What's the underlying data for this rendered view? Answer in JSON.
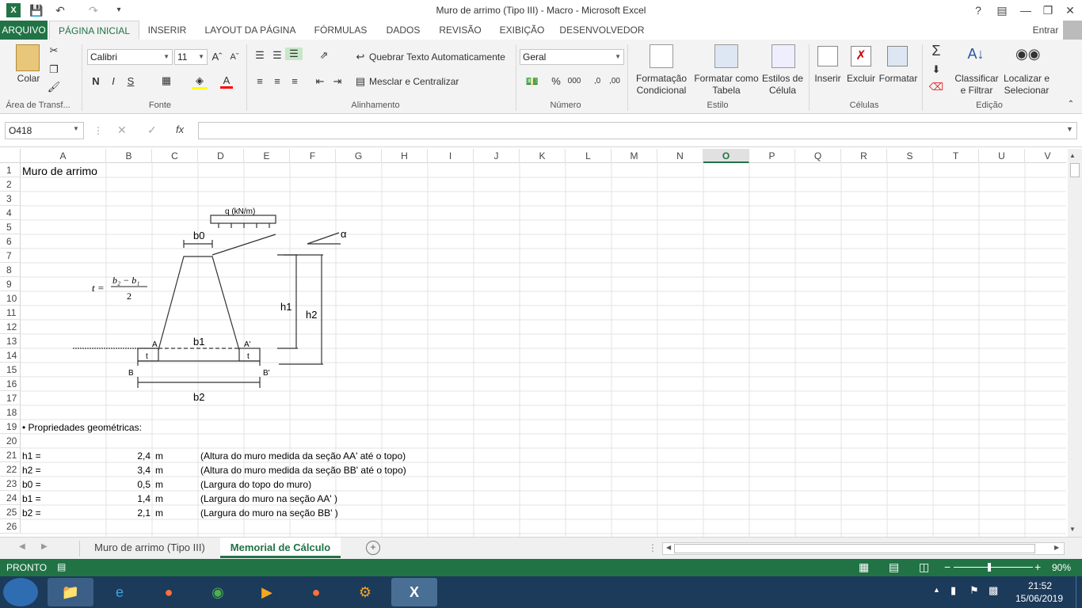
{
  "titlebar": {
    "title": "Muro de arrimo (Tipo III) - Macro - Microsoft Excel",
    "help": "?"
  },
  "tabs": [
    "ARQUIVO",
    "PÁGINA INICIAL",
    "INSERIR",
    "LAYOUT DA PÁGINA",
    "FÓRMULAS",
    "DADOS",
    "REVISÃO",
    "EXIBIÇÃO",
    "DESENVOLVEDOR"
  ],
  "signin": "Entrar",
  "ribbon": {
    "paste": "Colar",
    "font_name": "Calibri",
    "font_size": "11",
    "bold": "N",
    "italic": "I",
    "underline": "S",
    "wrap_text": "Quebrar Texto Automaticamente",
    "merge_center": "Mesclar e Centralizar",
    "number_format": "Geral",
    "cond_format": [
      "Formatação",
      "Condicional"
    ],
    "format_table": [
      "Formatar como",
      "Tabela"
    ],
    "cell_styles": [
      "Estilos de",
      "Célula"
    ],
    "insert": "Inserir",
    "delete": "Excluir",
    "format": "Formatar",
    "sort_filter": [
      "Classificar",
      "e Filtrar"
    ],
    "find_select": [
      "Localizar e",
      "Selecionar"
    ],
    "groups": {
      "clipboard": "Área de Transf...",
      "font": "Fonte",
      "alignment": "Alinhamento",
      "number": "Número",
      "styles": "Estilo",
      "cells": "Células",
      "editing": "Edição"
    }
  },
  "formula_bar": {
    "name_box": "O418",
    "fx": "fx",
    "value": ""
  },
  "columns": [
    "A",
    "B",
    "C",
    "D",
    "E",
    "F",
    "G",
    "H",
    "I",
    "J",
    "K",
    "L",
    "M",
    "N",
    "O",
    "P",
    "Q",
    "R",
    "S",
    "T",
    "U",
    "V"
  ],
  "selected_column": "O",
  "rows": [
    "1",
    "2",
    "3",
    "4",
    "5",
    "6",
    "7",
    "8",
    "9",
    "10",
    "11",
    "12",
    "13",
    "14",
    "15",
    "16",
    "17",
    "18",
    "19",
    "20",
    "21",
    "22",
    "23",
    "24",
    "25",
    "26"
  ],
  "cells": {
    "a1": "Muro de arrimo",
    "a19": "• Propriedades geométricas:",
    "table": [
      {
        "label": "h1 =",
        "value": "2,4",
        "unit": "m",
        "desc": "(Altura do muro medida da seção AA' até o topo)"
      },
      {
        "label": "h2 =",
        "value": "3,4",
        "unit": "m",
        "desc": "(Altura do muro medida da seção BB' até o topo)"
      },
      {
        "label": "b0 =",
        "value": "0,5",
        "unit": "m",
        "desc": "(Largura do topo do muro)"
      },
      {
        "label": "b1 =",
        "value": "1,4",
        "unit": "m",
        "desc": "(Largura do muro na seção AA' )"
      },
      {
        "label": "b2 =",
        "value": "2,1",
        "unit": "m",
        "desc": "(Largura do muro na seção BB' )"
      }
    ]
  },
  "diagram": {
    "q": "q (kN/m)",
    "alpha": "α",
    "b0": "b0",
    "b1": "b1",
    "b2": "b2",
    "h1": "h1",
    "h2": "h2",
    "A": "A",
    "A2": "A'",
    "B": "B",
    "B2": "B'",
    "t": "t",
    "formula": {
      "t_eq": "t =",
      "num": "b₂ − b₁",
      "den": "2"
    }
  },
  "sheets": [
    "Muro de arrimo (Tipo III)",
    "Memorial de Cálculo"
  ],
  "active_sheet": 1,
  "status": {
    "mode": "PRONTO",
    "zoom": "90%"
  },
  "clock": {
    "time": "21:52",
    "date": "15/06/2019"
  }
}
